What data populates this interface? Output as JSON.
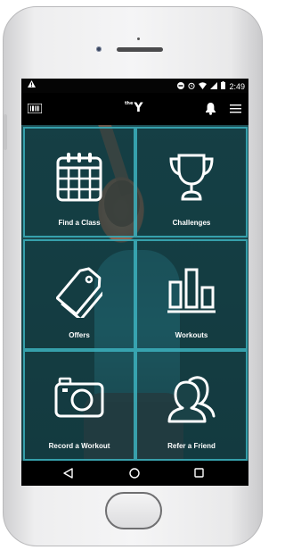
{
  "status_bar": {
    "time": "2:49",
    "warning_icon": "alert-triangle-icon"
  },
  "app_bar": {
    "logo_text": "Y",
    "logo_prefix": "the",
    "left_icon": "barcode-icon",
    "right_icons": [
      "bell-icon",
      "menu-icon"
    ]
  },
  "tiles": [
    {
      "label": "Find a Class",
      "icon": "calendar-icon"
    },
    {
      "label": "Challenges",
      "icon": "trophy-icon"
    },
    {
      "label": "Offers",
      "icon": "tags-icon"
    },
    {
      "label": "Workouts",
      "icon": "bar-chart-icon"
    },
    {
      "label": "Record a Workout",
      "icon": "camera-icon"
    },
    {
      "label": "Refer a Friend",
      "icon": "users-icon"
    }
  ],
  "nav_bar": {
    "icons": [
      "back-icon",
      "home-icon",
      "recent-apps-icon"
    ]
  },
  "colors": {
    "tile_border": "#3cb2be",
    "background": "#1d4c52",
    "bar": "#000000"
  }
}
